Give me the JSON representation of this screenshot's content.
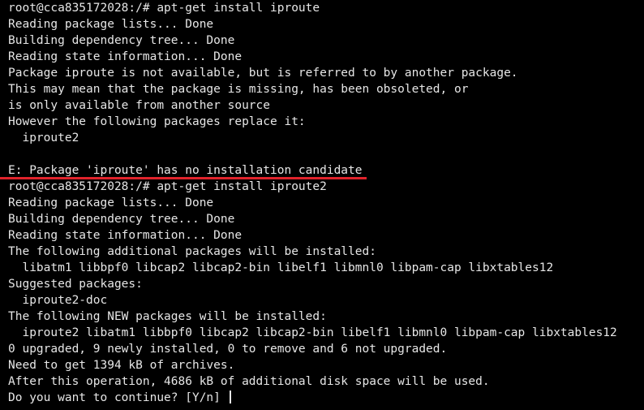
{
  "terminal": {
    "lines": [
      "root@cca835172028:/# apt-get install iproute",
      "Reading package lists... Done",
      "Building dependency tree... Done",
      "Reading state information... Done",
      "Package iproute is not available, but is referred to by another package.",
      "This may mean that the package is missing, has been obsoleted, or",
      "is only available from another source",
      "However the following packages replace it:",
      "  iproute2",
      "",
      "E: Package 'iproute' has no installation candidate",
      "root@cca835172028:/# apt-get install iproute2",
      "Reading package lists... Done",
      "Building dependency tree... Done",
      "Reading state information... Done",
      "The following additional packages will be installed:",
      "  libatm1 libbpf0 libcap2 libcap2-bin libelf1 libmnl0 libpam-cap libxtables12",
      "Suggested packages:",
      "  iproute2-doc",
      "The following NEW packages will be installed:",
      "  iproute2 libatm1 libbpf0 libcap2 libcap2-bin libelf1 libmnl0 libpam-cap libxtables12",
      "0 upgraded, 9 newly installed, 0 to remove and 6 not upgraded.",
      "Need to get 1394 kB of archives.",
      "After this operation, 4686 kB of additional disk space will be used.",
      "Do you want to continue? [Y/n] "
    ]
  },
  "colors": {
    "background": "#000000",
    "text": "#e6e6e6",
    "error_underline": "#e0232b"
  }
}
